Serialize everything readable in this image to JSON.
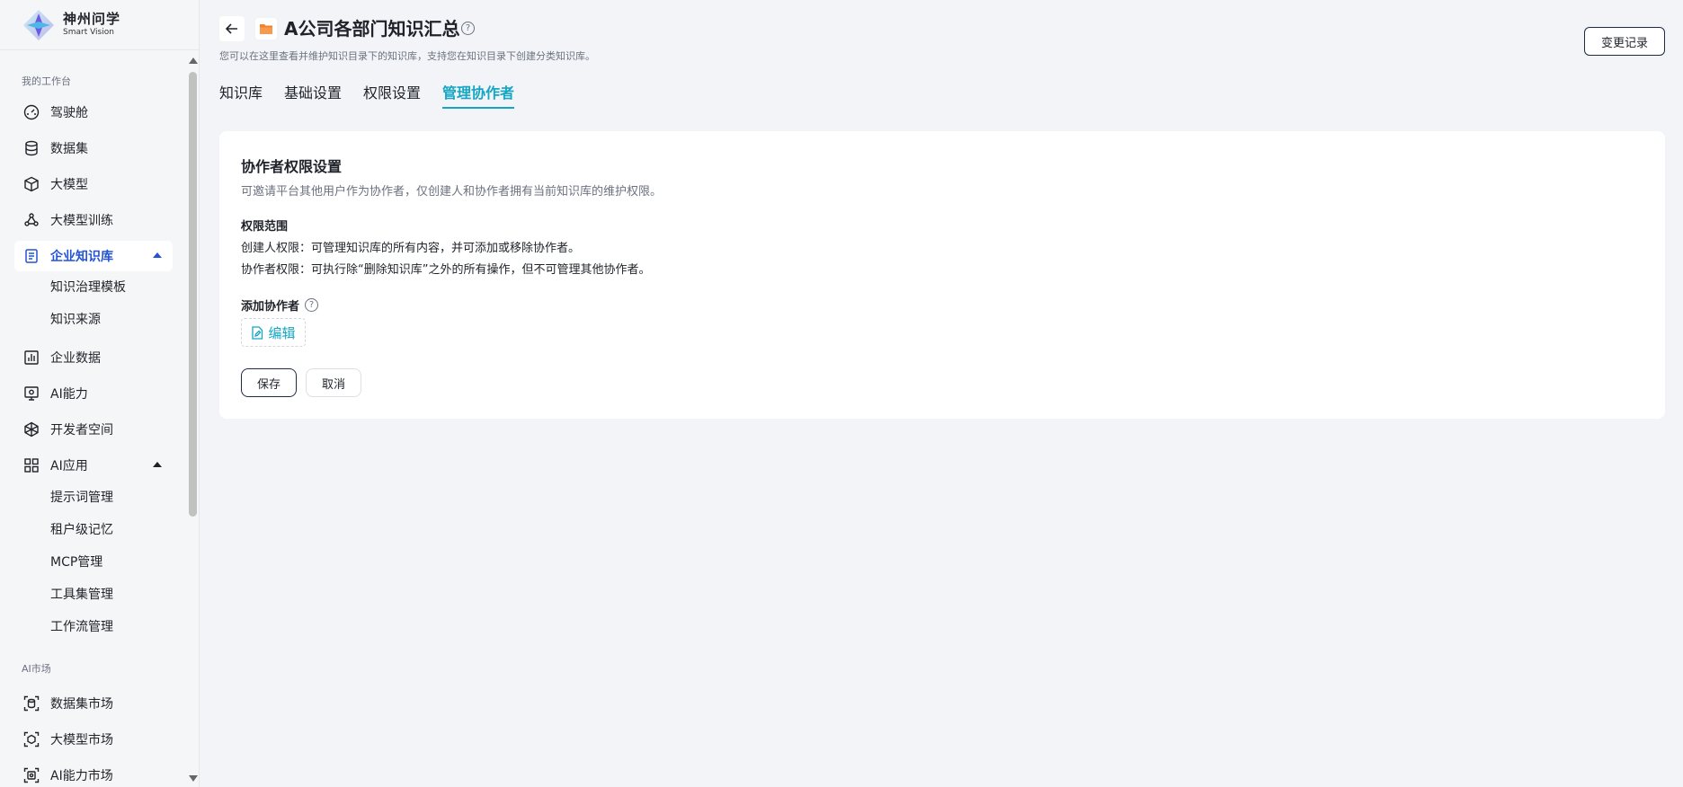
{
  "brand": {
    "name_cn": "神州问学",
    "name_en": "Smart Vision"
  },
  "sidebar": {
    "section_workspace": "我的工作台",
    "section_market": "AI市场",
    "items": [
      {
        "label": "驾驶舱",
        "icon": "gauge-icon"
      },
      {
        "label": "数据集",
        "icon": "database-icon"
      },
      {
        "label": "大模型",
        "icon": "cube-icon"
      },
      {
        "label": "大模型训练",
        "icon": "training-icon"
      },
      {
        "label": "企业知识库",
        "icon": "knowledge-icon"
      },
      {
        "label": "企业数据",
        "icon": "bar-chart-icon"
      },
      {
        "label": "AI能力",
        "icon": "ai-ability-icon"
      },
      {
        "label": "开发者空间",
        "icon": "developer-icon"
      },
      {
        "label": "AI应用",
        "icon": "grid-icon"
      }
    ],
    "knowledge_sub": [
      "知识治理模板",
      "知识来源"
    ],
    "ai_app_sub": [
      "提示词管理",
      "租户级记忆",
      "MCP管理",
      "工具集管理",
      "工作流管理"
    ],
    "market_items": [
      {
        "label": "数据集市场",
        "icon": "dataset-market-icon"
      },
      {
        "label": "大模型市场",
        "icon": "model-market-icon"
      },
      {
        "label": "AI能力市场",
        "icon": "ai-market-icon"
      }
    ]
  },
  "header": {
    "title": "A公司各部门知识汇总",
    "subtitle": "您可以在这里查看并维护知识目录下的知识库，支持您在知识目录下创建分类知识库。",
    "change_log": "变更记录"
  },
  "tabs": [
    "知识库",
    "基础设置",
    "权限设置",
    "管理协作者"
  ],
  "active_tab": "管理协作者",
  "card": {
    "title": "协作者权限设置",
    "desc": "可邀请平台其他用户作为协作者，仅创建人和协作者拥有当前知识库的维护权限。",
    "scope_title": "权限范围",
    "scope_creator": "创建人权限：可管理知识库的所有内容，并可添加或移除协作者。",
    "scope_collaborator": "协作者权限：可执行除“删除知识库”之外的所有操作，但不可管理其他协作者。",
    "add_title": "添加协作者",
    "edit_label": "编辑",
    "save_label": "保存",
    "cancel_label": "取消"
  },
  "colors": {
    "accent": "#14a6c4",
    "active_nav": "#2454d6",
    "folder": "#f5822a"
  }
}
